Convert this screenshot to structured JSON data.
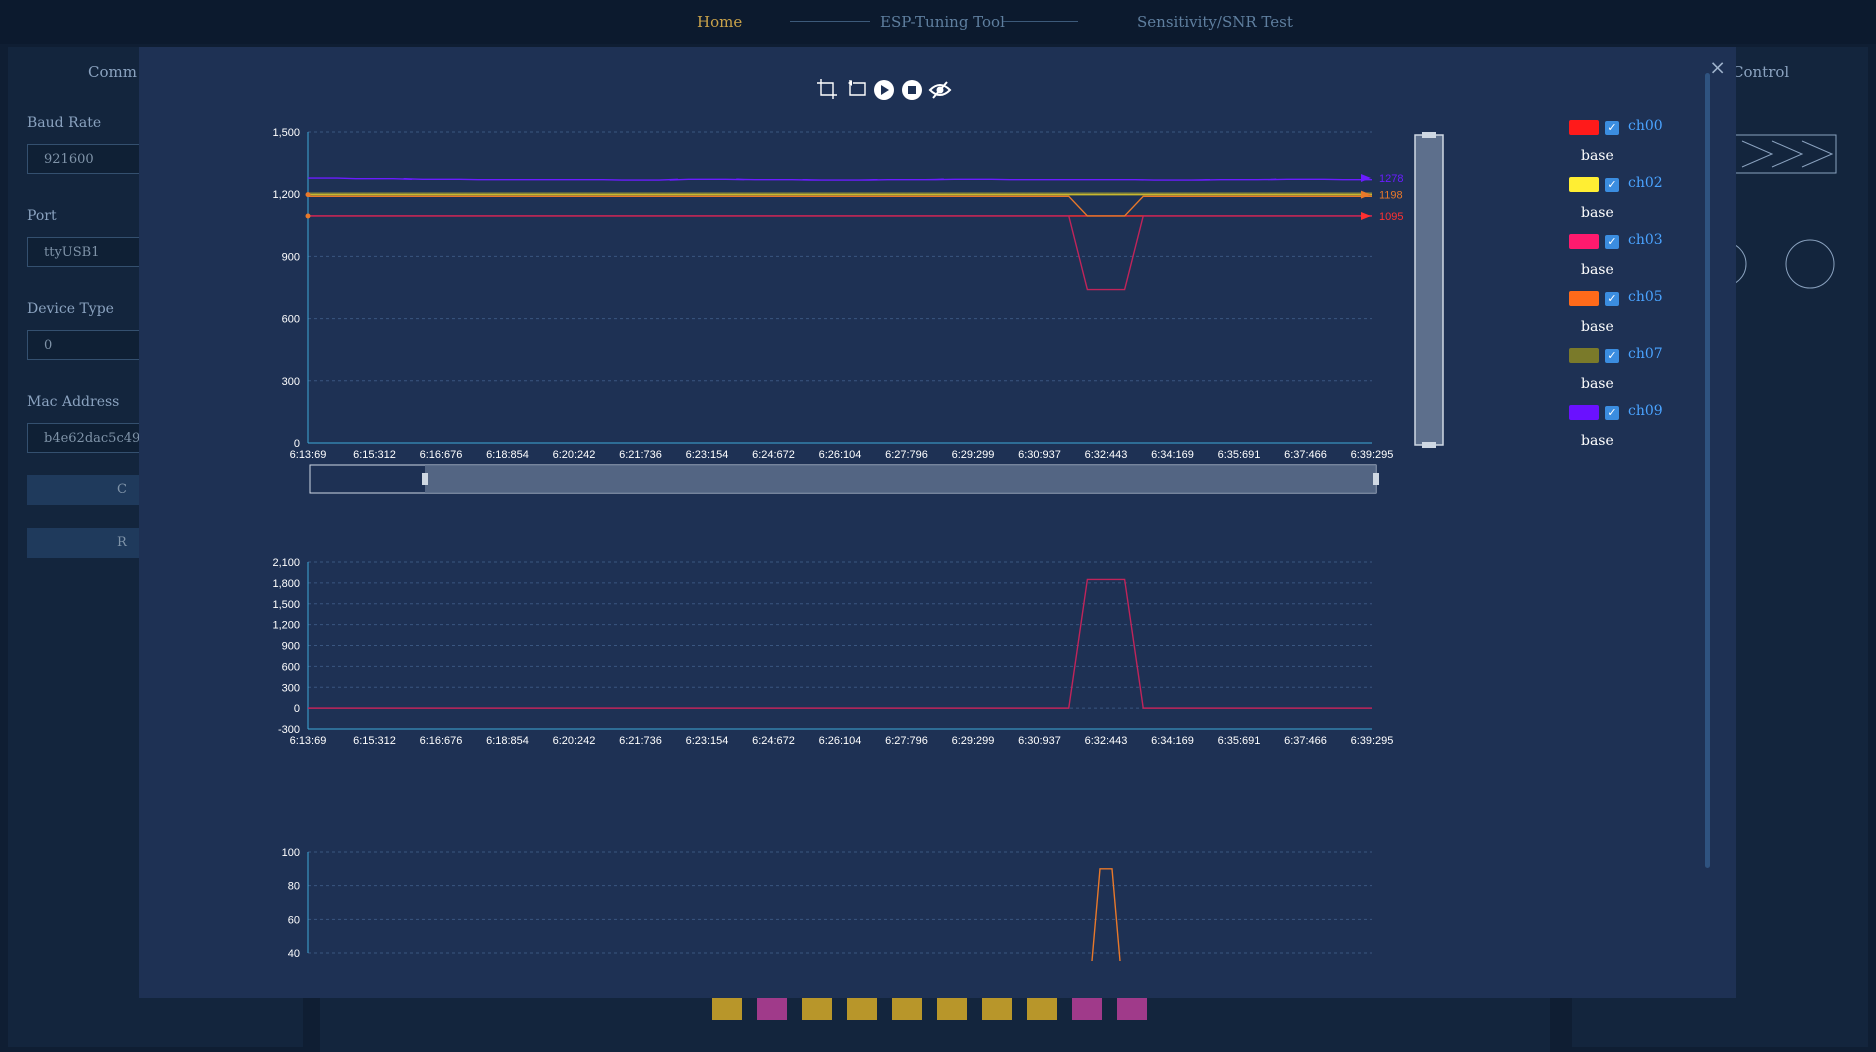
{
  "nav": {
    "home": "Home",
    "esp": "ESP-Tuning Tool",
    "sensitivity": "Sensitivity/SNR Test"
  },
  "background": {
    "left_section_title": "Comm",
    "right_section_title": "Control",
    "fields": [
      {
        "label": "Baud Rate",
        "value": "921600"
      },
      {
        "label": "Port",
        "value": "ttyUSB1"
      },
      {
        "label": "Device Type",
        "value": "0"
      },
      {
        "label": "Mac Address",
        "value": "b4e62dac5c49"
      }
    ],
    "button1_label": "C",
    "button2_label": "R"
  },
  "modal": {
    "close_label": "×"
  },
  "toolbar": [
    "zoom-area-icon",
    "zoom-reset-icon",
    "play-icon",
    "stop-icon",
    "hide-icon"
  ],
  "legend": [
    {
      "name": "ch00",
      "color": "#ff1a1a",
      "sub": "base"
    },
    {
      "name": "ch02",
      "color": "#ffee33",
      "sub": "base"
    },
    {
      "name": "ch03",
      "color": "#ff1a6e",
      "sub": "base"
    },
    {
      "name": "ch05",
      "color": "#ff6a1a",
      "sub": "base"
    },
    {
      "name": "ch07",
      "color": "#7a7a2a",
      "sub": "base"
    },
    {
      "name": "ch09",
      "color": "#6a11ff",
      "sub": "base"
    }
  ],
  "chart_data": [
    {
      "type": "line",
      "x": [
        "6:13:69",
        "6:15:312",
        "6:16:676",
        "6:18:854",
        "6:20:242",
        "6:21:736",
        "6:23:154",
        "6:24:672",
        "6:26:104",
        "6:27:796",
        "6:29:299",
        "6:30:937",
        "6:32:443",
        "6:34:169",
        "6:35:691",
        "6:37:466",
        "6:39:295"
      ],
      "ylim": [
        0,
        1500
      ],
      "yticks": [
        "0",
        "300",
        "600",
        "900",
        "1,200",
        "1,500"
      ],
      "series": [
        {
          "name": "ch00",
          "color": "#ff3030",
          "values": [
            1095,
            1095,
            1095,
            1095,
            1095,
            1095,
            1095,
            1095,
            1095,
            1095,
            1095,
            1095,
            1095,
            1095,
            1095,
            1095,
            1095
          ]
        },
        {
          "name": "ch02",
          "color": "#c8b82e",
          "values": [
            1198,
            1198,
            1198,
            1198,
            1198,
            1198,
            1198,
            1198,
            1198,
            1198,
            1198,
            1198,
            1198,
            1198,
            1198,
            1198,
            1198
          ]
        },
        {
          "name": "ch03",
          "color": "#c0245a",
          "values": [
            1095,
            1095,
            1095,
            1095,
            1095,
            1095,
            1095,
            1095,
            1095,
            1095,
            1095,
            1095,
            740,
            1095,
            1095,
            1095,
            1095
          ]
        },
        {
          "name": "ch05",
          "color": "#e8782a",
          "values": [
            1190,
            1190,
            1190,
            1190,
            1190,
            1190,
            1190,
            1190,
            1190,
            1190,
            1190,
            1190,
            1095,
            1190,
            1190,
            1190,
            1190
          ]
        },
        {
          "name": "ch07",
          "color": "#8a8a3a",
          "values": [
            1205,
            1205,
            1205,
            1205,
            1205,
            1205,
            1205,
            1205,
            1205,
            1205,
            1205,
            1205,
            1205,
            1205,
            1205,
            1205,
            1205
          ]
        },
        {
          "name": "ch09",
          "color": "#6a1cff",
          "values": [
            1278,
            1275,
            1272,
            1270,
            1270,
            1268,
            1272,
            1270,
            1268,
            1270,
            1272,
            1270,
            1270,
            1268,
            1270,
            1272,
            1270
          ]
        }
      ],
      "end_labels": [
        "1278",
        "1198",
        "1095"
      ]
    },
    {
      "type": "line",
      "x": [
        "6:13:69",
        "6:15:312",
        "6:16:676",
        "6:18:854",
        "6:20:242",
        "6:21:736",
        "6:23:154",
        "6:24:672",
        "6:26:104",
        "6:27:796",
        "6:29:299",
        "6:30:937",
        "6:32:443",
        "6:34:169",
        "6:35:691",
        "6:37:466",
        "6:39:295"
      ],
      "ylim": [
        -300,
        2100
      ],
      "yticks": [
        "-300",
        "0",
        "300",
        "600",
        "900",
        "1,200",
        "1,500",
        "1,800",
        "2,100"
      ],
      "series": [
        {
          "color": "#c0245a",
          "values": [
            0,
            0,
            0,
            0,
            0,
            0,
            0,
            0,
            0,
            0,
            0,
            0,
            1850,
            0,
            0,
            0,
            0
          ]
        }
      ]
    },
    {
      "type": "line",
      "ylim": [
        40,
        100
      ],
      "yticks": [
        "40",
        "60",
        "80",
        "100"
      ],
      "series": [
        {
          "color": "#e8782a",
          "values": [
            null,
            null,
            null,
            null,
            null,
            null,
            null,
            null,
            null,
            null,
            null,
            null,
            90,
            null,
            null,
            null,
            null
          ]
        }
      ]
    }
  ]
}
